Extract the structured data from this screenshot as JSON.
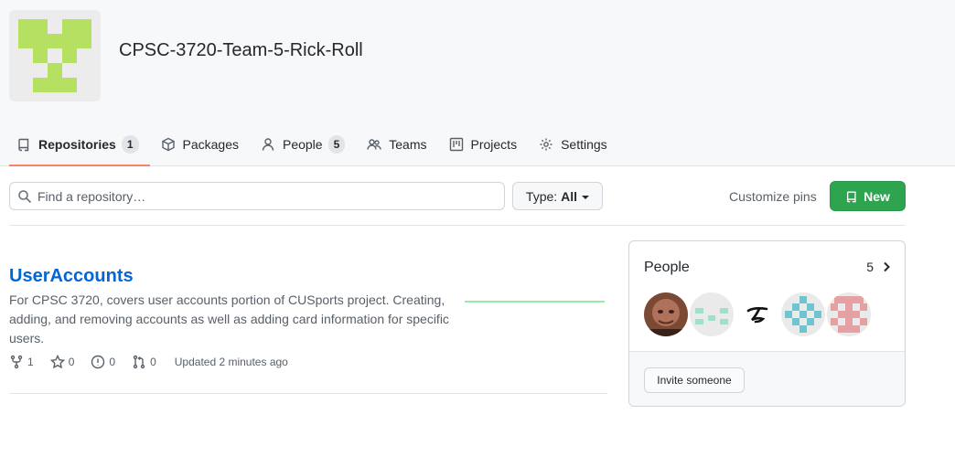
{
  "org": {
    "name": "CPSC-3720-Team-5-Rick-Roll",
    "avatar_color": "#b5e061"
  },
  "tabs": [
    {
      "label": "Repositories",
      "count": "1",
      "icon": "repo-icon",
      "active": true
    },
    {
      "label": "Packages",
      "icon": "package-icon"
    },
    {
      "label": "People",
      "count": "5",
      "icon": "person-icon"
    },
    {
      "label": "Teams",
      "icon": "people-icon"
    },
    {
      "label": "Projects",
      "icon": "project-icon"
    },
    {
      "label": "Settings",
      "icon": "gear-icon"
    }
  ],
  "search": {
    "placeholder": "Find a repository…",
    "value": ""
  },
  "type_filter": {
    "label": "Type:",
    "value": "All"
  },
  "customize_pins": "Customize pins",
  "new_button": "New",
  "repo": {
    "name": "UserAccounts",
    "description": "For CPSC 3720, covers user accounts portion of CUSports project. Creating, adding, and removing accounts as well as adding card information for specific users.",
    "forks": "1",
    "stars": "0",
    "issues": "0",
    "pull_requests": "0",
    "updated": "Updated 2 minutes ago",
    "activity_color": "#9be9a8"
  },
  "people": {
    "title": "People",
    "count": "5",
    "avatars": [
      "photo-avatar",
      "mint-identicon",
      "script-logo-avatar",
      "teal-identicon",
      "pink-identicon"
    ],
    "invite_label": "Invite someone"
  },
  "colors": {
    "accent": "#2ea44f",
    "link": "#0366d6",
    "tab_underline": "#f9826c"
  }
}
